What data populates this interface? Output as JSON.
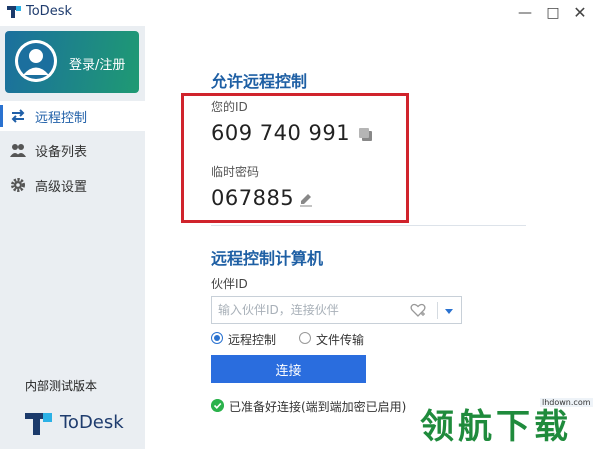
{
  "window": {
    "title": "ToDesk",
    "minimize": "—",
    "maximize": "□",
    "close": "✕"
  },
  "sidebar": {
    "login_label": "登录/注册",
    "items": [
      {
        "label": "远程控制",
        "icon": "swap-arrows-icon",
        "active": true
      },
      {
        "label": "设备列表",
        "icon": "users-icon",
        "active": false
      },
      {
        "label": "高级设置",
        "icon": "gear-icon",
        "active": false
      }
    ],
    "version_label": "内部测试版本",
    "brand_name": "ToDesk"
  },
  "allow_section": {
    "title": "允许远程控制",
    "id_label": "您的ID",
    "id_value": "609 740 991",
    "password_label": "临时密码",
    "password_value": "067885"
  },
  "control_section": {
    "title": "远程控制计算机",
    "partner_label": "伙伴ID",
    "partner_placeholder": "输入伙伴ID，连接伙伴",
    "partner_value": "",
    "modes": [
      {
        "label": "远程控制",
        "selected": true
      },
      {
        "label": "文件传输",
        "selected": false
      }
    ],
    "connect_label": "连接",
    "status_text": "已准备好连接(端到端加密已启用)"
  },
  "watermark": {
    "url": "lhdown.com",
    "text": "领航下载"
  },
  "colors": {
    "accent": "#2a6dde",
    "heading": "#1e5fa4",
    "highlight_box": "#d0232c",
    "status_ok": "#2bb24c",
    "watermark": "#1f8b3c"
  }
}
